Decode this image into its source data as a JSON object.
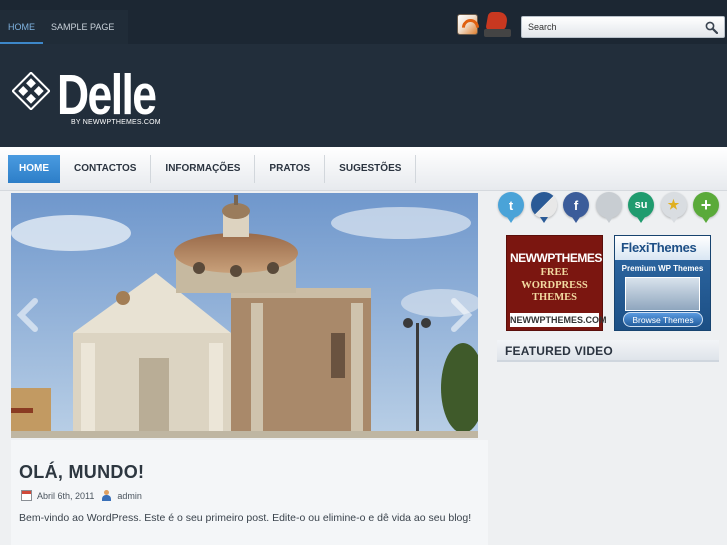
{
  "topnav": {
    "items": [
      {
        "label": "HOME",
        "active": true
      },
      {
        "label": "SAMPLE PAGE",
        "active": false
      }
    ]
  },
  "header_icons": [
    "rss-feed-icon",
    "bookmark-icon"
  ],
  "search": {
    "placeholder": "Search",
    "value": "Search"
  },
  "logo": {
    "title": "Delle",
    "byline": "BY NEWWPTHEMES.COM"
  },
  "mainnav": {
    "items": [
      {
        "label": "HOME",
        "active": true
      },
      {
        "label": "CONTACTOS",
        "active": false
      },
      {
        "label": "INFORMAÇÕES",
        "active": false
      },
      {
        "label": "PRATOS",
        "active": false
      },
      {
        "label": "SUGESTÕES",
        "active": false
      }
    ]
  },
  "post": {
    "title": "OLÁ, MUNDO!",
    "date": "Abril 6th, 2011",
    "author": "admin",
    "excerpt": "Bem-vindo ao WordPress. Este é o seu primeiro post. Edite-o ou elimine-o e dê vida ao seu blog!"
  },
  "social_icons": [
    {
      "name": "twitter-icon",
      "glyph": "t",
      "color": "#4aa3d8"
    },
    {
      "name": "delicious-icon",
      "glyph": "",
      "color": "#2a5a96"
    },
    {
      "name": "facebook-icon",
      "glyph": "f",
      "color": "#3b5c9a"
    },
    {
      "name": "digg-icon",
      "glyph": "",
      "color": "#c8cdd2"
    },
    {
      "name": "stumbleupon-icon",
      "glyph": "su",
      "color": "#1f9b6e"
    },
    {
      "name": "favorite-star-icon",
      "glyph": "★",
      "color": "#d9dde1"
    },
    {
      "name": "add-plus-icon",
      "glyph": "+",
      "color": "#5aaa3a"
    }
  ],
  "ads": {
    "newwp": {
      "line1": "NEWWPTHEMES",
      "line2": "FREE",
      "line3": "WORDPRESS",
      "line4": "THEMES",
      "url": "NEWWPTHEMES.COM"
    },
    "flexi": {
      "title": "FlexiThemes",
      "subtitle": "Premium WP Themes",
      "button": "Browse Themes"
    }
  },
  "sidebar": {
    "featured_video": "FEATURED VIDEO"
  },
  "colors": {
    "header_bg": "#222e3b",
    "accent": "#3d87c9",
    "nav_active": "#2d7ec8"
  }
}
